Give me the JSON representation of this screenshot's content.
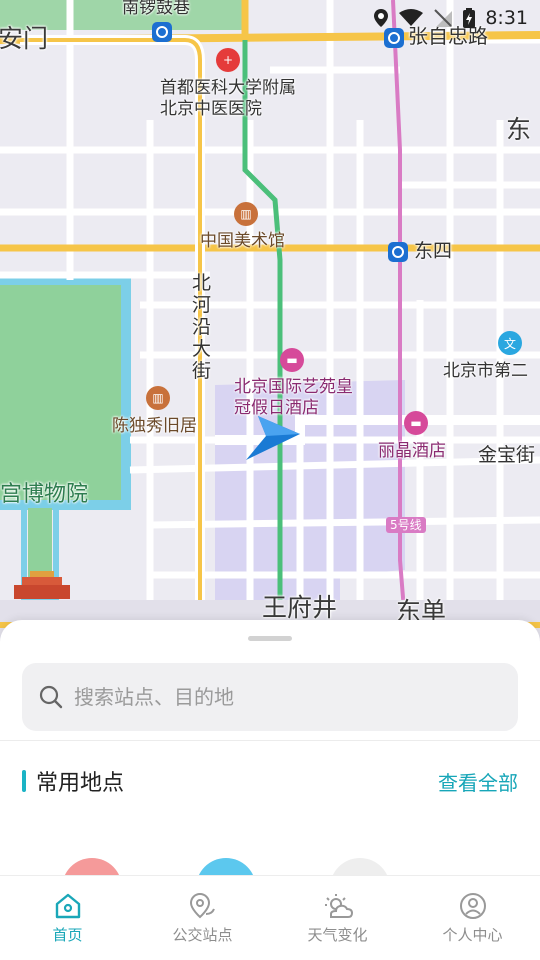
{
  "status_bar": {
    "time": "8:31",
    "icons": [
      "location-icon",
      "wifi-icon",
      "no-sim-icon",
      "battery-icon"
    ]
  },
  "map": {
    "labels": {
      "nanluoguxiang": "南锣鼓巷",
      "anmen": "安门",
      "zhangzizhonglu": "张自忠路",
      "hospital": "首都医科大学附属北京中医医院",
      "dong_edge": "东",
      "art_museum": "中国美术馆",
      "dongsi": "东四",
      "beiheyan": "北河沿大街",
      "beijingshi": "北京市第二",
      "hotel_name": "北京国际艺苑皇冠假日酒店",
      "chen_duxiu": "陈独秀旧居",
      "lijing": "丽晶酒店",
      "jinbao": "金宝街",
      "palace_museum": "宫博物院",
      "line5": "5号线",
      "wangfujing": "王府井",
      "dongdan": "东单"
    },
    "colors": {
      "water": "#7ccfe8",
      "park": "#7dcb8c",
      "highlight": "#d8d4f2",
      "metro5": "#d97bc4",
      "road_major": "#f6c548",
      "road_green": "#4bbf7a",
      "nav_arrow": "#1a7ad4"
    }
  },
  "search": {
    "placeholder": "搜索站点、目的地",
    "value": ""
  },
  "favorites": {
    "title": "常用地点",
    "view_all": "查看全部",
    "chip_colors": [
      "#f59a9a",
      "#5cc8ee",
      "#eeeeee"
    ]
  },
  "tabbar": {
    "items": [
      {
        "label": "首页",
        "icon": "home-icon",
        "active": true
      },
      {
        "label": "公交站点",
        "icon": "bus-stop-pin-icon",
        "active": false
      },
      {
        "label": "天气变化",
        "icon": "weather-icon",
        "active": false
      },
      {
        "label": "个人中心",
        "icon": "user-center-icon",
        "active": false
      }
    ],
    "active_color": "#1aa7b8"
  }
}
